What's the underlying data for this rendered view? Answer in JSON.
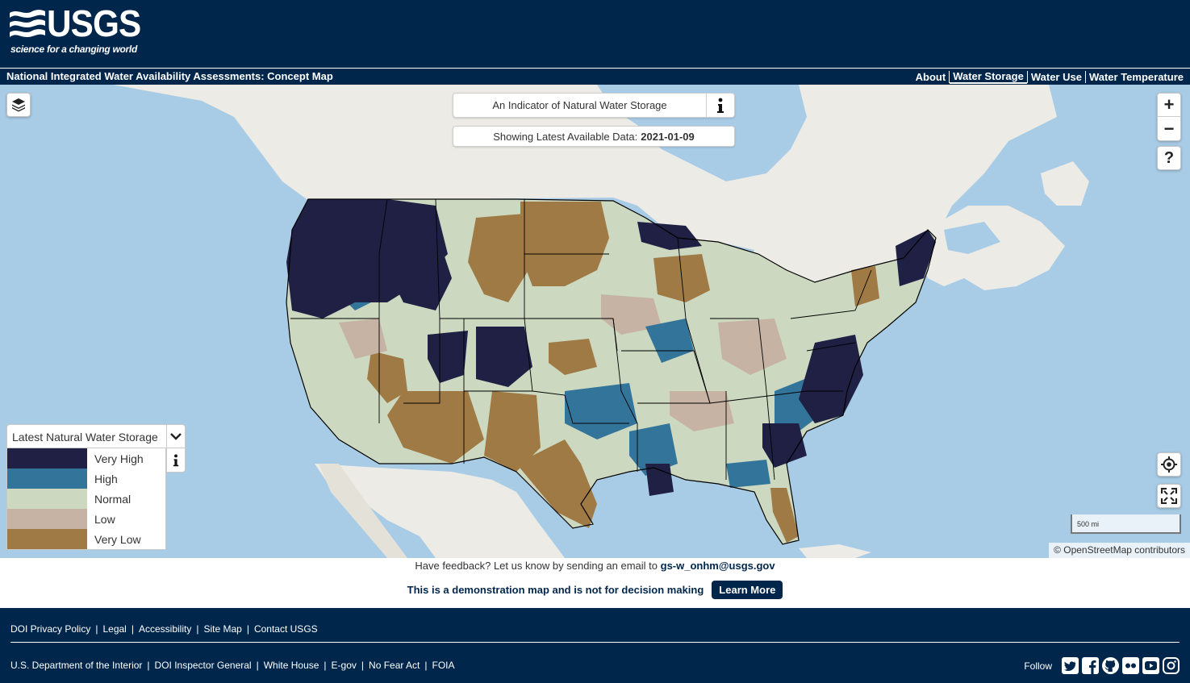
{
  "header": {
    "logo_text": "USGS",
    "tagline": "science for a changing world"
  },
  "nav": {
    "site_title": "National Integrated Water Availability Assessments: Concept Map",
    "links": [
      {
        "label": "About",
        "active": false
      },
      {
        "label": "Water Storage",
        "active": true
      },
      {
        "label": "Water Use",
        "active": false
      },
      {
        "label": "Water Temperature",
        "active": false
      }
    ]
  },
  "map": {
    "indicator_title": "An Indicator of Natural Water Storage",
    "date_prefix": "Showing Latest Available Data:",
    "date_value": "2021-01-09",
    "scale_label": "500 mi",
    "attribution": "© OpenStreetMap contributors",
    "legend": {
      "title": "Latest Natural Water Storage",
      "items": [
        {
          "label": "Very High",
          "color": "#1f2044"
        },
        {
          "label": "High",
          "color": "#33749a"
        },
        {
          "label": "Normal",
          "color": "#cdd8c0"
        },
        {
          "label": "Low",
          "color": "#c6b3a4"
        },
        {
          "label": "Very Low",
          "color": "#9f7a45"
        }
      ]
    },
    "colors": {
      "water": "#a9cce6",
      "land": "#ecebe5"
    },
    "controls": {
      "layers_icon": "layers-icon",
      "zoom_in": "+",
      "zoom_out": "−",
      "help": "?",
      "locate_icon": "locate-icon",
      "fullscreen_icon": "fullscreen-icon"
    }
  },
  "feedback": {
    "text": "Have feedback? Let us know by sending an email to",
    "email": "gs-w_onhm@usgs.gov"
  },
  "notice": {
    "text": "This is a demonstration map and is not for decision making",
    "button_label": "Learn More"
  },
  "footer": {
    "links_top": [
      "DOI Privacy Policy",
      "Legal",
      "Accessibility",
      "Site Map",
      "Contact USGS"
    ],
    "links_bottom": [
      "U.S. Department of the Interior",
      "DOI Inspector General",
      "White House",
      "E-gov",
      "No Fear Act",
      "FOIA"
    ],
    "follow_label": "Follow",
    "social_icons": [
      "twitter-icon",
      "facebook-icon",
      "github-icon",
      "flickr-icon",
      "youtube-icon",
      "instagram-icon"
    ]
  }
}
